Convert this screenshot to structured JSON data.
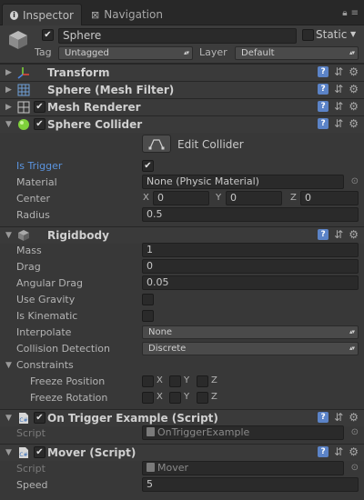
{
  "tabs": [
    {
      "label": "Inspector",
      "icon": "info-icon",
      "active": true
    },
    {
      "label": "Navigation",
      "icon": "navigation-icon",
      "active": false
    }
  ],
  "gameobject": {
    "active": true,
    "name": "Sphere",
    "static_label": "Static",
    "static": false,
    "tag_label": "Tag",
    "tag_value": "Untagged",
    "layer_label": "Layer",
    "layer_value": "Default"
  },
  "components": {
    "transform": {
      "title": "Transform"
    },
    "mesh_filter": {
      "title": "Sphere (Mesh Filter)"
    },
    "mesh_renderer": {
      "title": "Mesh Renderer",
      "enabled": true
    },
    "sphere_collider": {
      "title": "Sphere Collider",
      "enabled": true,
      "edit_label": "Edit Collider",
      "is_trigger_label": "Is Trigger",
      "is_trigger": true,
      "material_label": "Material",
      "material_value": "None (Physic Material)",
      "center_label": "Center",
      "center": {
        "x_label": "X",
        "x": "0",
        "y_label": "Y",
        "y": "0",
        "z_label": "Z",
        "z": "0"
      },
      "radius_label": "Radius",
      "radius": "0.5"
    },
    "rigidbody": {
      "title": "Rigidbody",
      "mass_label": "Mass",
      "mass": "1",
      "drag_label": "Drag",
      "drag": "0",
      "angular_drag_label": "Angular Drag",
      "angular_drag": "0.05",
      "use_gravity_label": "Use Gravity",
      "use_gravity": false,
      "is_kinematic_label": "Is Kinematic",
      "is_kinematic": false,
      "interpolate_label": "Interpolate",
      "interpolate": "None",
      "collision_label": "Collision Detection",
      "collision": "Discrete",
      "constraints_label": "Constraints",
      "freeze_position_label": "Freeze Position",
      "freeze_rotation_label": "Freeze Rotation",
      "axis_x": "X",
      "axis_y": "Y",
      "axis_z": "Z"
    },
    "on_trigger": {
      "title": "On Trigger Example (Script)",
      "enabled": true,
      "script_label": "Script",
      "script_value": "OnTriggerExample"
    },
    "mover": {
      "title": "Mover (Script)",
      "enabled": true,
      "script_label": "Script",
      "script_value": "Mover",
      "speed_label": "Speed",
      "speed": "5"
    }
  },
  "colors": {
    "background": "#383838",
    "tabbar": "#282828",
    "accent_blue": "#5b95e0",
    "help_blue": "#5b83c7",
    "collider_green": "#7fd13b"
  }
}
